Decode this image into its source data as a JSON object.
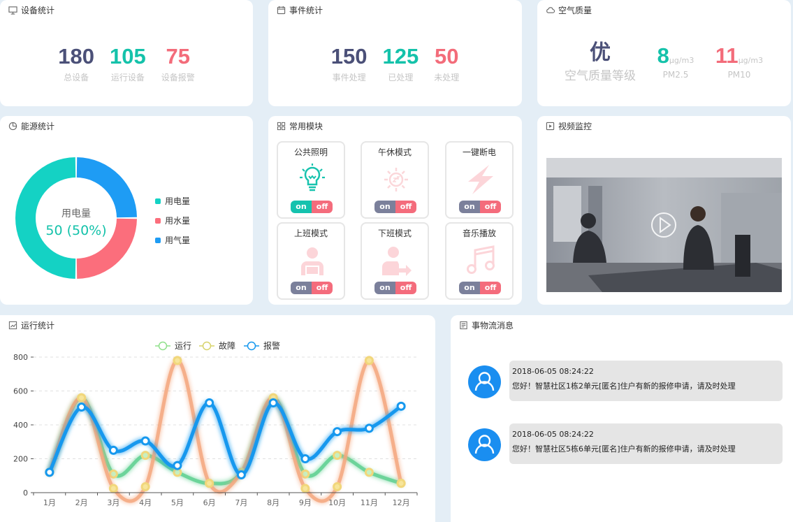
{
  "device_stats": {
    "title": "设备统计",
    "items": [
      {
        "value": "180",
        "label": "总设备"
      },
      {
        "value": "105",
        "label": "运行设备"
      },
      {
        "value": "75",
        "label": "设备报警"
      }
    ]
  },
  "event_stats": {
    "title": "事件统计",
    "items": [
      {
        "value": "150",
        "label": "事件处理"
      },
      {
        "value": "125",
        "label": "已处理"
      },
      {
        "value": "50",
        "label": "未处理"
      }
    ]
  },
  "air_quality": {
    "title": "空气质量",
    "grade": "优",
    "grade_label": "空气质量等级",
    "pm25": {
      "value": "8",
      "unit": "μg/m3",
      "label": "PM2.5"
    },
    "pm10": {
      "value": "11",
      "unit": "μg/m3",
      "label": "PM10"
    }
  },
  "energy": {
    "title": "能源统计",
    "center_label": "用电量",
    "center_value": "50 (50%)",
    "legend": [
      {
        "label": "用电量",
        "color": "#14d2c4"
      },
      {
        "label": "用水量",
        "color": "#fb6e7c"
      },
      {
        "label": "用气量",
        "color": "#1e9cf4"
      }
    ],
    "slices": [
      50,
      25,
      25
    ]
  },
  "modules": {
    "title": "常用模块",
    "on_label": "on",
    "off_label": "off",
    "items": [
      {
        "label": "公共照明",
        "icon": "bulb-icon",
        "state": "on"
      },
      {
        "label": "午休模式",
        "icon": "sun-icon",
        "state": "off"
      },
      {
        "label": "一键断电",
        "icon": "lightning-icon",
        "state": "off"
      },
      {
        "label": "上班模式",
        "icon": "work-person-icon",
        "state": "off"
      },
      {
        "label": "下班模式",
        "icon": "leave-person-icon",
        "state": "off"
      },
      {
        "label": "音乐播放",
        "icon": "music-icon",
        "state": "off"
      }
    ]
  },
  "video": {
    "title": "视频监控"
  },
  "run_stats": {
    "title": "运行统计"
  },
  "messages": {
    "title": "事物流消息",
    "items": [
      {
        "time": "2018-06-05 08:24:22",
        "text": "您好！智慧社区1栋2单元[匿名]住户有新的报修申请，请及时处理"
      },
      {
        "time": "2018-06-05 08:24:22",
        "text": "您好！智慧社区5栋6单元[匿名]住户有新的报修申请，请及时处理"
      }
    ]
  },
  "chart_data": {
    "type": "line",
    "categories": [
      "1月",
      "2月",
      "3月",
      "4月",
      "5月",
      "6月",
      "7月",
      "8月",
      "9月",
      "10月",
      "11月",
      "12月"
    ],
    "ylim": [
      0,
      800
    ],
    "yticks": [
      0,
      200,
      400,
      600,
      800
    ],
    "grid": true,
    "legend_position": "top-center",
    "series": [
      {
        "name": "运行",
        "color": "#6cd49a",
        "values": [
          120,
          560,
          110,
          220,
          120,
          55,
          120,
          560,
          110,
          220,
          120,
          55
        ]
      },
      {
        "name": "故障",
        "color": "#f5a77e",
        "values": [
          120,
          560,
          25,
          35,
          780,
          55,
          120,
          560,
          25,
          35,
          780,
          55
        ]
      },
      {
        "name": "报警",
        "color": "#1598ee",
        "values": [
          120,
          505,
          250,
          305,
          160,
          530,
          105,
          530,
          200,
          360,
          380,
          510
        ]
      }
    ]
  }
}
